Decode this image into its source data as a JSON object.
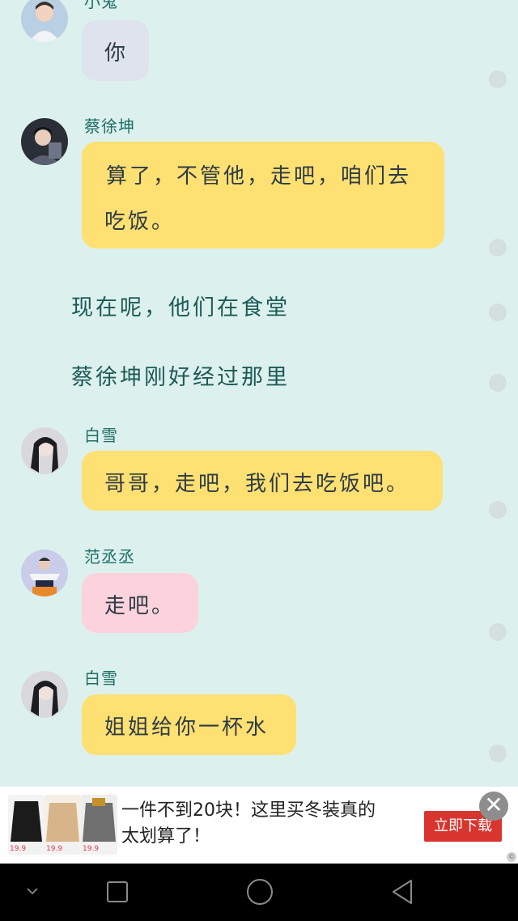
{
  "messages": [
    {
      "sender": "小鬼",
      "text": "你"
    },
    {
      "sender": "蔡徐坤",
      "line1": "算了，不管他，走吧，咱们去",
      "line2": "吃饭。"
    },
    {
      "sender": "白雪",
      "text": "哥哥，走吧，我们去吃饭吧。"
    },
    {
      "sender": "范丞丞",
      "text": "走吧。"
    },
    {
      "sender": "白雪",
      "text": "姐姐给你一杯水"
    }
  ],
  "narration": [
    "现在呢，他们在食堂",
    "蔡徐坤刚好经过那里"
  ],
  "ad": {
    "line1": "一件不到20块！这里买冬装真的",
    "line2": "太划算了！",
    "button": "立即下载",
    "close": "✕",
    "mark": "©",
    "prices": [
      "19.9",
      "19.9",
      "19.9"
    ]
  },
  "colors": {
    "background": "#dcf1ee",
    "bubble_yellow": "#ffe072",
    "bubble_pink": "#fcd3dc",
    "bubble_gray": "#dfe3ee",
    "ad_button": "#d8352f"
  },
  "nav": {
    "back": "chevron-down-icon",
    "home": "circle-home-icon",
    "recent": "square-recent-icon",
    "back2": "triangle-back-icon"
  }
}
